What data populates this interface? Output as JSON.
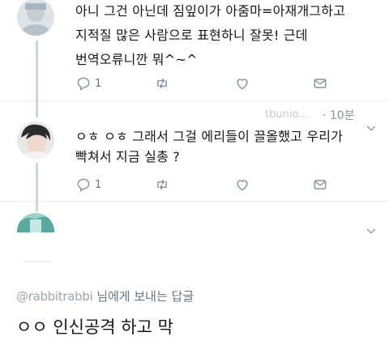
{
  "tweets": [
    {
      "text_lines": [
        "아니 그건 아닌데 짐잎이가 아줌마=아재개그하고",
        "지적질 많은 사람으로 표현하니 잘못! 근데",
        "번역오류니깐 뭐^~^"
      ],
      "reply_count": "1",
      "actions": [
        "reply-icon",
        "retweet-icon",
        "like-icon",
        "dm-icon"
      ]
    },
    {
      "handle_fragment": "tbunio...",
      "time": "· 10분",
      "text_lines": [
        "ㅇㅎ ㅇㅎ 그래서 그걸 에리들이 끌올했고 우리가",
        "빡쳐서 지금 실총 ?"
      ],
      "reply_count": "1",
      "actions": [
        "reply-icon",
        "retweet-icon",
        "like-icon",
        "dm-icon"
      ]
    },
    {
      "actions": [
        "caret-down-icon"
      ]
    }
  ],
  "reply_context": {
    "prefix": "@rabbitrabbi",
    "suffix": "님에게 보내는 답글"
  },
  "compose_text": "ㅇㅇ 인신공격 하고 막",
  "colors": {
    "text": "#14171a",
    "secondary": "#8a96a3",
    "thread_line": "#ccd6dd",
    "divider": "#e6ecf0"
  }
}
